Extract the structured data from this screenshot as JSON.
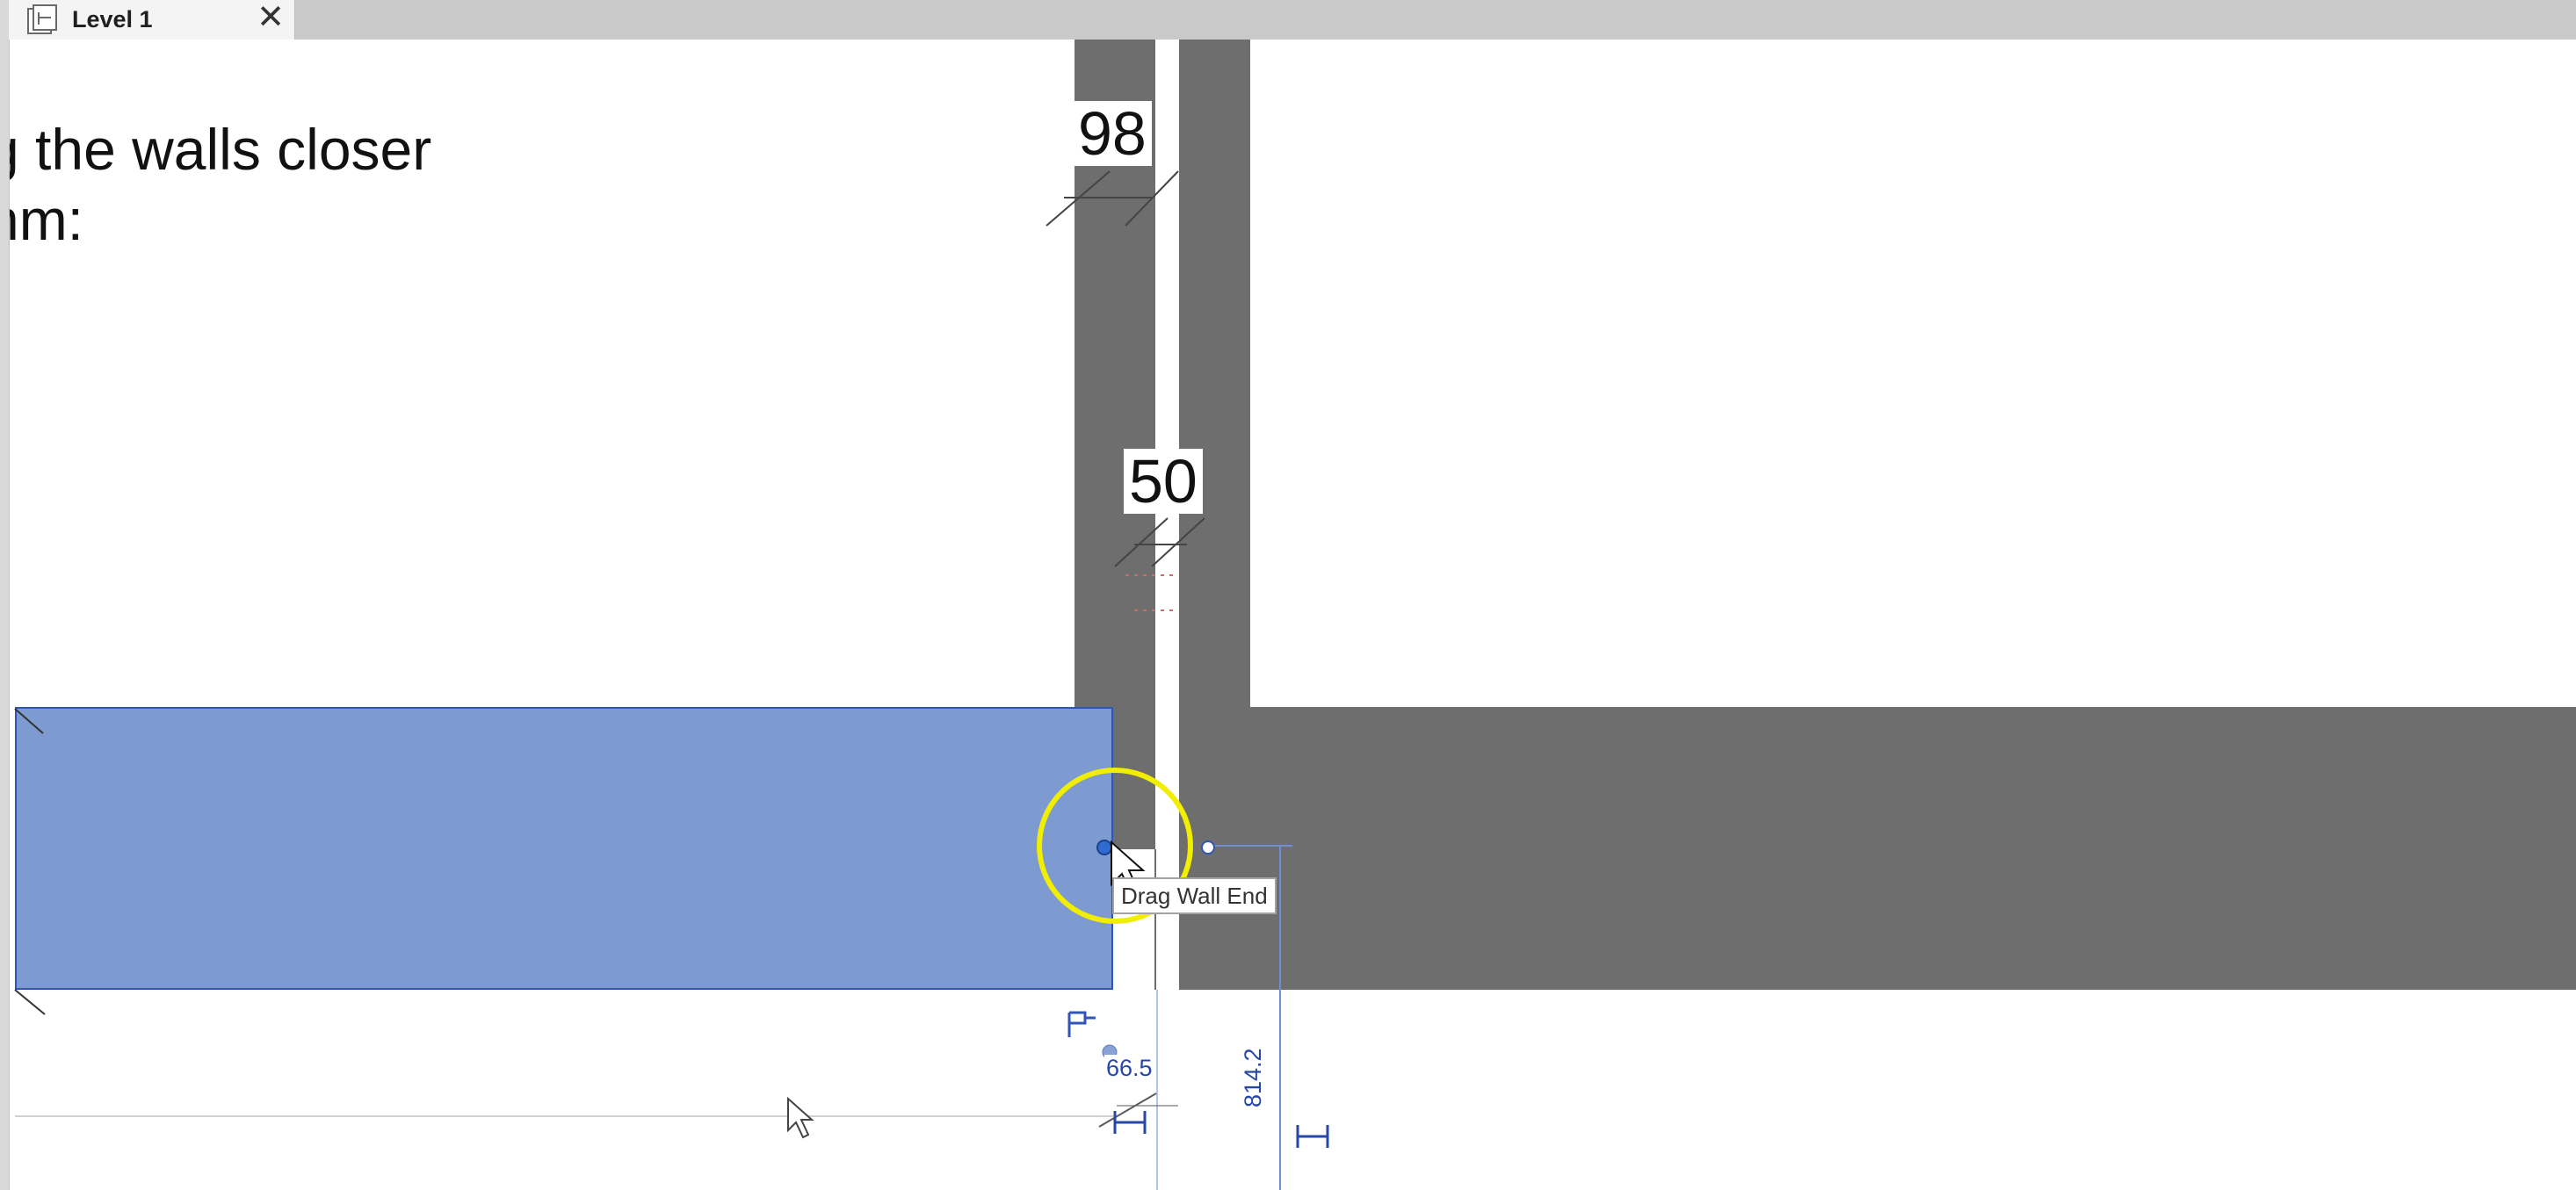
{
  "tab": {
    "label": "Level 1",
    "icon": "floor-plan-view-icon",
    "close_icon": "close-icon",
    "close_glyph": "✕"
  },
  "note": {
    "line1": "g the walls closer",
    "line2": "nm:"
  },
  "dimensions": {
    "wall_98": "98",
    "wall_50": "50"
  },
  "temporary_dimensions": {
    "bottom": "66.5",
    "vertical": "814.2"
  },
  "tooltip": "Drag Wall End",
  "colors": {
    "wall": "#6e6e6e",
    "selected_wall_fill": "#7d9bd1",
    "selected_wall_edge": "#2f56b7",
    "temp_dimension": "#2447a8",
    "highlight_ring": "#f2ee00"
  }
}
